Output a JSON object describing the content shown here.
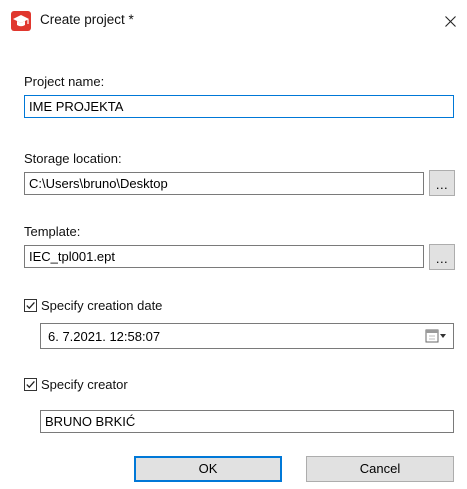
{
  "window": {
    "title": "Create project *",
    "accent_color": "#e0372e"
  },
  "project_name": {
    "label": "Project name:",
    "value": "IME PROJEKTA"
  },
  "storage_location": {
    "label": "Storage location:",
    "value": "C:\\Users\\bruno\\Desktop",
    "browse_label": "..."
  },
  "template": {
    "label": "Template:",
    "value": "IEC_tpl001.ept",
    "browse_label": "..."
  },
  "creation_date": {
    "checkbox_label": "Specify creation date",
    "checked": true,
    "value": "6.  7.2021. 12:58:07"
  },
  "creator": {
    "checkbox_label": "Specify creator",
    "checked": true,
    "value": "BRUNO BRKIĆ"
  },
  "buttons": {
    "ok": "OK",
    "cancel": "Cancel"
  },
  "icons": {
    "app": "graduation-cap-icon",
    "close": "close-icon",
    "calendar": "calendar-dropdown-icon",
    "check": "checkmark-icon"
  }
}
